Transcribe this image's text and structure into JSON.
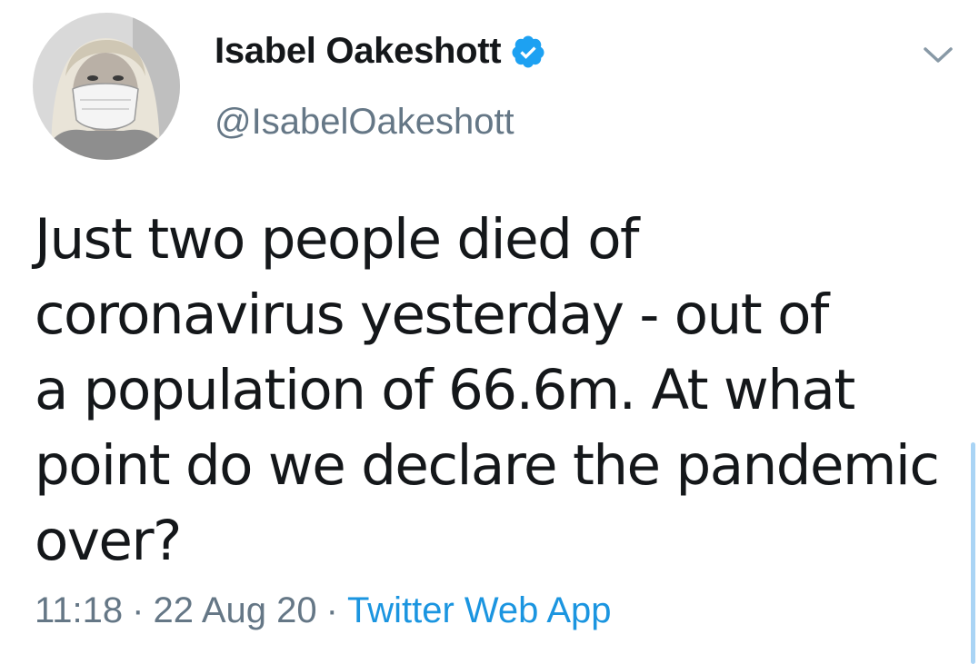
{
  "user": {
    "display_name": "Isabel Oakeshott",
    "handle": "@IsabelOakeshott",
    "verified": true,
    "avatar_icon": "avatar-photo"
  },
  "menu": {
    "icon": "chevron-down-icon"
  },
  "tweet": {
    "lines": [
      "Just two people died of",
      "coronavirus yesterday - out of",
      "a population of 66.6m. At what",
      "point do we declare the pandemic",
      "over?"
    ]
  },
  "meta": {
    "time": "11:18",
    "separator": "·",
    "date": "22 Aug 20",
    "source": "Twitter Web App"
  },
  "colors": {
    "text": "#14171a",
    "secondary": "#657786",
    "link": "#1b95e0",
    "verified": "#1da1f2"
  }
}
